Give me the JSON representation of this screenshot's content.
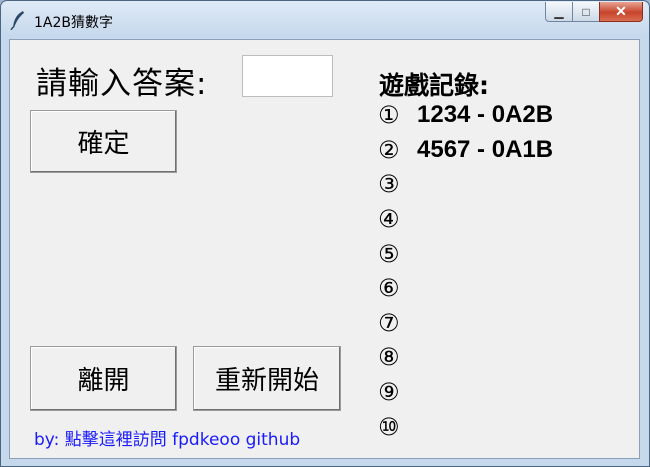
{
  "window": {
    "title": "1A2B猜數字",
    "close_glyph": "✕",
    "min_glyph": "▁",
    "max_glyph": "□"
  },
  "form": {
    "prompt_label": "請輸入答案:",
    "answer_value": "",
    "confirm_label": "確定"
  },
  "buttons": {
    "leave_label": "離開",
    "restart_label": "重新開始"
  },
  "footer": {
    "link_text": "by: 點擊這裡訪問 fpdkeoo github"
  },
  "history": {
    "title": "遊戲記錄:",
    "entries": [
      {
        "num": "①",
        "text": "1234 - 0A2B"
      },
      {
        "num": "②",
        "text": "4567 - 0A1B"
      },
      {
        "num": "③",
        "text": ""
      },
      {
        "num": "④",
        "text": ""
      },
      {
        "num": "⑤",
        "text": ""
      },
      {
        "num": "⑥",
        "text": ""
      },
      {
        "num": "⑦",
        "text": ""
      },
      {
        "num": "⑧",
        "text": ""
      },
      {
        "num": "⑨",
        "text": ""
      },
      {
        "num": "⑩",
        "text": ""
      }
    ]
  },
  "icons": {
    "app": "feather-icon",
    "minimize": "minimize-icon",
    "maximize": "maximize-icon",
    "close": "close-icon"
  }
}
